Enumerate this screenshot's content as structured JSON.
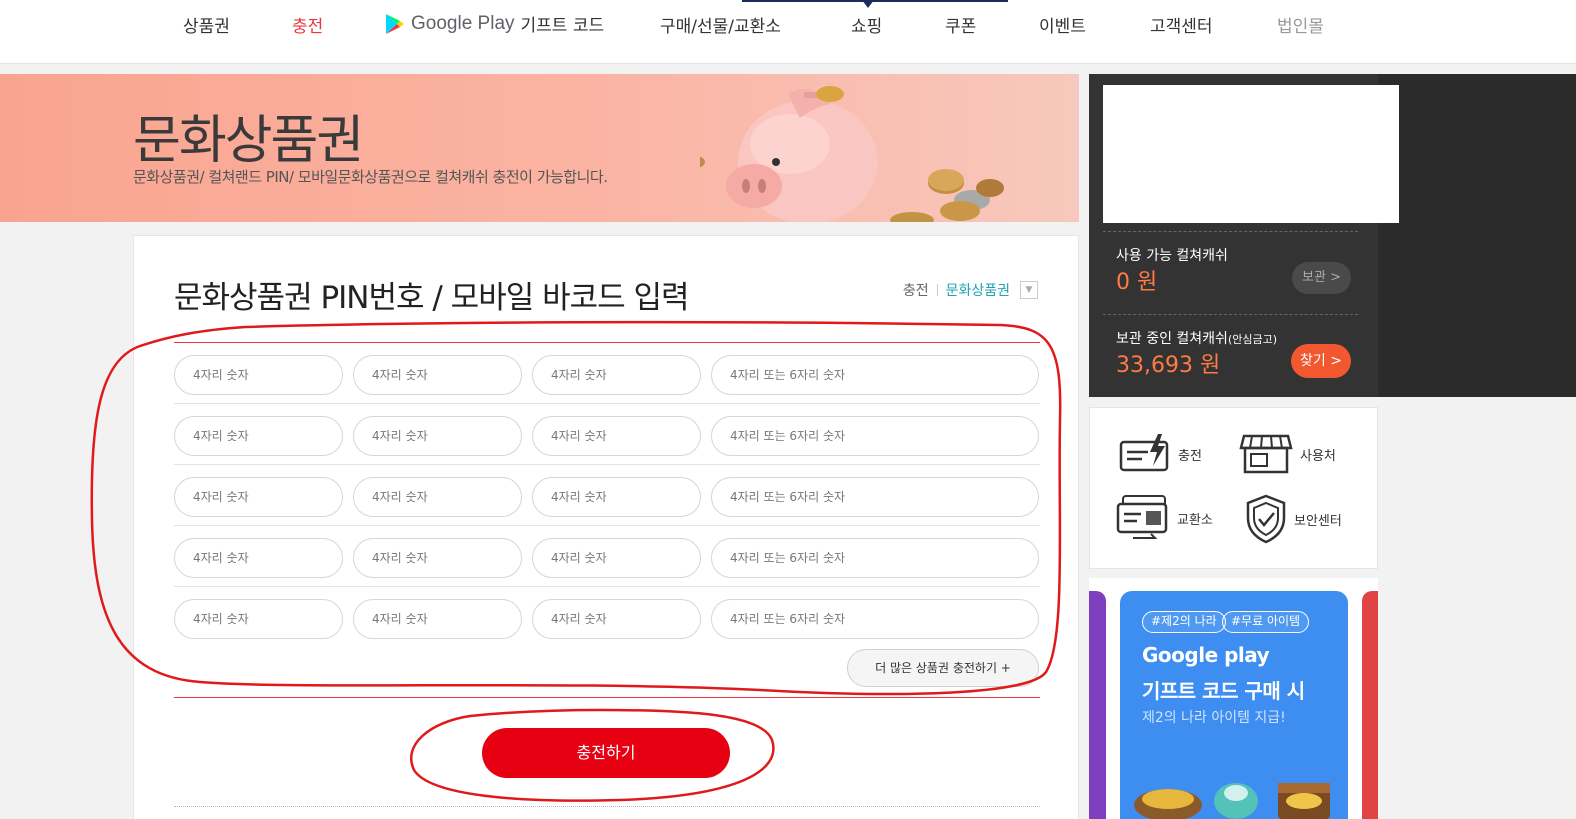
{
  "nav": {
    "items": [
      "상품권",
      "충전",
      "기프트 코드",
      "구매/선물/교환소",
      "쇼핑",
      "쿠폰",
      "이벤트",
      "고객센터",
      "법인몰"
    ],
    "google_play_brand": "Google Play",
    "active_color": "#e8383d"
  },
  "banner": {
    "title": "문화상품권",
    "subtitle": "문화상품권/ 컬쳐랜드 PIN/ 모바일문화상품권으로 컬쳐캐쉬 충전이 가능합니다."
  },
  "form": {
    "title": "문화상품권 PIN번호 / 모바일 바코드 입력",
    "breadcrumb_home": "충전",
    "breadcrumb_current": "문화상품권",
    "pin_placeholder_4": "4자리 숫자",
    "pin_placeholder_last": "4자리 또는 6자리 숫자",
    "more_button": "더 많은 상품권 충전하기 +",
    "charge_button": "충전하기",
    "accent_color": "#e60012"
  },
  "sidebar": {
    "available_label": "사용 가능 컬쳐캐쉬",
    "available_value": "0 원",
    "keep_button": "보관 >",
    "stored_label": "보관 중인 컬쳐캐쉬",
    "stored_label_small": "(안심금고)",
    "stored_value": "33,693 원",
    "find_button": "찾기 >",
    "menu": [
      {
        "label": "충전",
        "icon": "charge-card-icon"
      },
      {
        "label": "사용처",
        "icon": "store-icon"
      },
      {
        "label": "교환소",
        "icon": "exchange-card-icon"
      },
      {
        "label": "보안센터",
        "icon": "shield-check-icon"
      }
    ]
  },
  "promo": {
    "tag1": "#제2의 나라",
    "tag2": "#무료 아이템",
    "line1": "Google play",
    "line2": "기프트 코드 구매 시",
    "line3": "제2의 나라 아이템 지급!"
  }
}
